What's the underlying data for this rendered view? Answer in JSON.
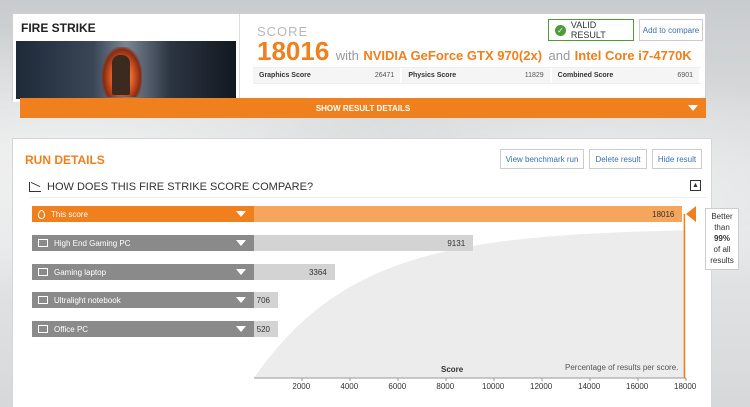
{
  "header": {
    "test_name": "FIRE STRIKE",
    "score_label": "SCORE",
    "score_value": "18016",
    "with_text": "with",
    "gpu": "NVIDIA GeForce GTX 970(2x)",
    "and_text": "and",
    "cpu": "Intel Core i7-4770K",
    "valid_label": "VALID RESULT",
    "compare_label": "Add to compare",
    "subscores": [
      {
        "label": "Graphics Score",
        "value": "26471"
      },
      {
        "label": "Physics Score",
        "value": "11829"
      },
      {
        "label": "Combined Score",
        "value": "6901"
      }
    ],
    "show_details": "SHOW RESULT DETAILS"
  },
  "run": {
    "title": "RUN DETAILS",
    "buttons": {
      "view": "View benchmark run",
      "delete": "Delete result",
      "hide": "Hide result"
    },
    "compare_heading": "HOW DOES THIS FIRE STRIKE SCORE COMPARE?",
    "collapse_icon": "collapse-icon"
  },
  "tooltip": {
    "line1": "Better",
    "line2": "than",
    "line3": "99%",
    "line4": "of all",
    "line5": "results"
  },
  "colors": {
    "accent": "#f07f1d",
    "valid": "#4f9b3a",
    "link": "#3a6fb0"
  },
  "chart_data": {
    "type": "bar",
    "categories": [
      "This score",
      "High End Gaming PC",
      "Gaming laptop",
      "Ultralight notebook",
      "Office PC"
    ],
    "values": [
      18016,
      9131,
      3364,
      706,
      520
    ],
    "xlabel": "Score",
    "annotation": "Percentage of results per score.",
    "xticks": [
      "2000",
      "4000",
      "6000",
      "8000",
      "10000",
      "12000",
      "14000",
      "16000",
      "18000"
    ],
    "xlim": [
      0,
      18000
    ],
    "icons": [
      "pin-icon",
      "laptop-icon",
      "laptop-icon",
      "laptop-icon",
      "laptop-icon"
    ]
  }
}
